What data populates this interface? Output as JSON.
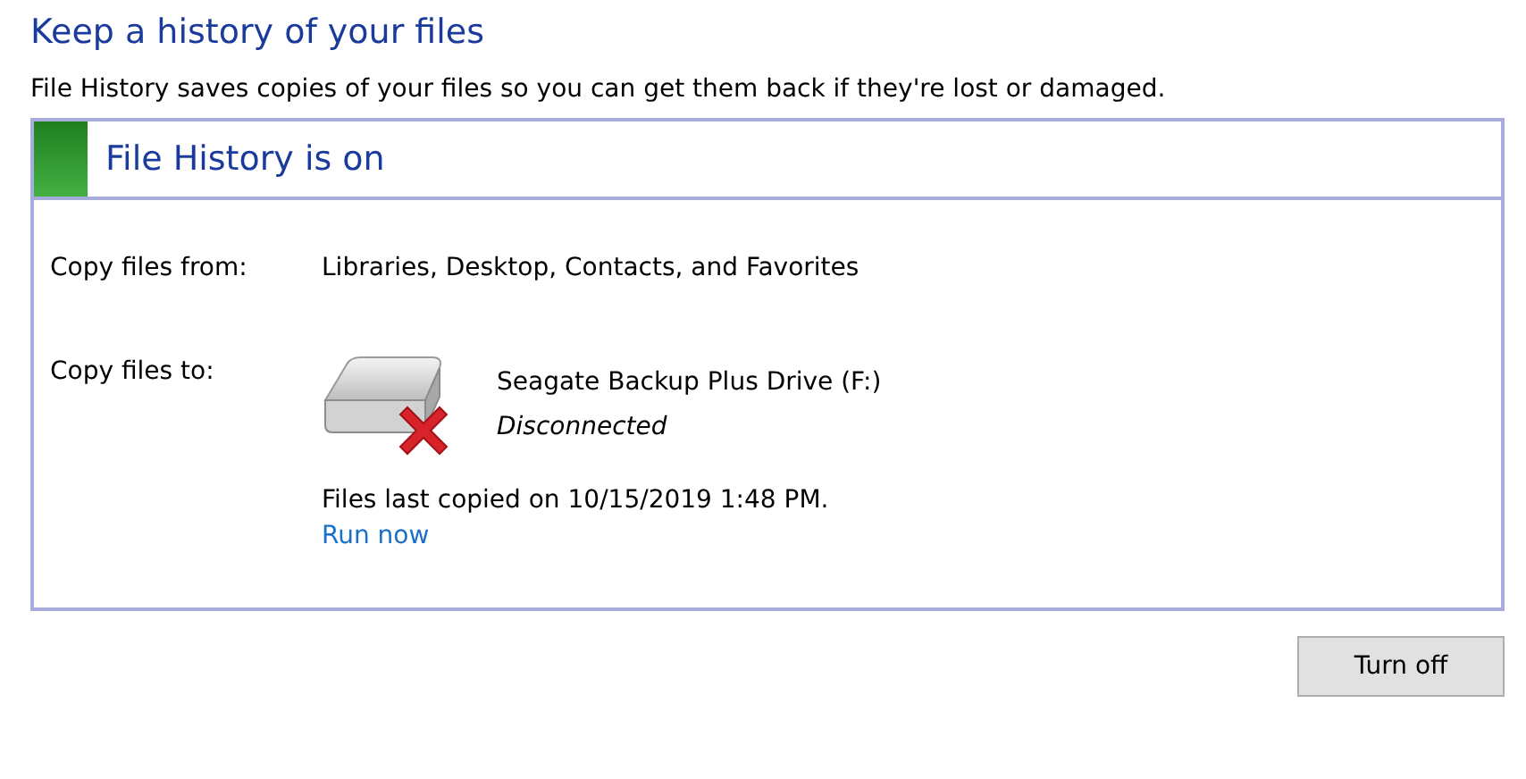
{
  "title": "Keep a history of your files",
  "description": "File History saves copies of your files so you can get them back if they're lost or damaged.",
  "status": {
    "heading": "File History is on",
    "on": true
  },
  "copy_from": {
    "label": "Copy files from:",
    "value": "Libraries, Desktop, Contacts, and Favorites"
  },
  "copy_to": {
    "label": "Copy files to:",
    "drive_name": "Seagate Backup Plus Drive (F:)",
    "drive_status": "Disconnected",
    "connected": false,
    "last_copied": "Files last copied on 10/15/2019 1:48 PM.",
    "run_link": "Run now"
  },
  "buttons": [
    "Turn off"
  ]
}
